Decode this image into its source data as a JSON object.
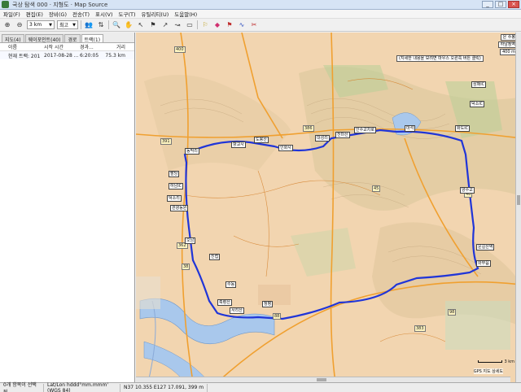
{
  "window": {
    "title": "국상 탐색 000 · 지형도 · Map Source",
    "min_label": "_",
    "max_label": "□",
    "close_label": "×"
  },
  "menu": [
    "파일(F)",
    "편집(E)",
    "장비(G)",
    "전송(T)",
    "표시(V)",
    "도구(T)",
    "유틸리티(U)",
    "도움말(H)"
  ],
  "toolbar": {
    "zoom_value": "3 km",
    "detail_value": "최고"
  },
  "left_panel": {
    "tabs": [
      "지도(4)",
      "웨이포인트(40)",
      "경로",
      "트랙(1)"
    ],
    "columns": [
      "이름",
      "시작 시간",
      "경과...",
      "거리"
    ],
    "rows": [
      {
        "name": "현재 트랙: 201...",
        "start": "2017-08-28 ...",
        "elapsed": "6:20:05",
        "distance": "75.3 km"
      }
    ]
  },
  "map": {
    "info_lines": [
      "은 수봉",
      "하남정역",
      "400 m"
    ],
    "note": "(지세한 내용을 보려면 마우스 오른쪽 버튼 클릭)",
    "scale": "3 km",
    "gps_label": "GPS 지도 상세도",
    "waypoints": [
      {
        "label": "동막리"
      },
      {
        "label": "향교사"
      },
      {
        "label": "도봉산"
      },
      {
        "label": "인화사"
      },
      {
        "label": "대성리"
      },
      {
        "label": "천마산"
      },
      {
        "label": "인수교차로"
      },
      {
        "label": "마석"
      },
      {
        "label": "화도IC"
      },
      {
        "label": "덕소IC"
      },
      {
        "label": "삼패IC"
      },
      {
        "label": "양수교"
      },
      {
        "label": "운길산역"
      },
      {
        "label": "와부읍"
      },
      {
        "label": "팔당"
      },
      {
        "label": "하남IC"
      },
      {
        "label": "덕소리"
      },
      {
        "label": "관광농원"
      },
      {
        "label": "오남"
      },
      {
        "label": "진접"
      },
      {
        "label": "수동"
      },
      {
        "label": "축령산"
      },
      {
        "label": "서리산"
      },
      {
        "label": "청평"
      }
    ],
    "road_numbers": [
      "400",
      "45",
      "386",
      "391",
      "362",
      "38",
      "46",
      "88",
      "98",
      "383"
    ]
  },
  "status": {
    "selection": "0개 항목이 선택됨",
    "format": "Lat/Lon hddd°mm.mmm' (WGS 84)",
    "position": "N37 10.355 E127 17.091, 399 m"
  },
  "colors": {
    "track": "#2035d8",
    "water": "#a9c8ec",
    "land": "#f2d5b0",
    "road_major": "#f0a030"
  }
}
